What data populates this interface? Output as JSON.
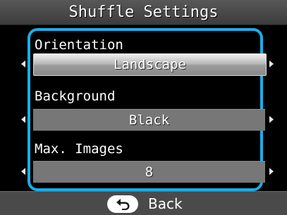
{
  "header": {
    "title": "Shuffle Settings"
  },
  "settings": [
    {
      "label": "Orientation",
      "value": "Landscape"
    },
    {
      "label": "Background",
      "value": "Black"
    },
    {
      "label": "Max. Images",
      "value": "8"
    }
  ],
  "footer": {
    "back_label": "Back",
    "back_icon": "return-arrow-icon"
  },
  "colors": {
    "panel_border": "#1aaee6",
    "selected_fill": "#bdbdbd",
    "unselected_fill": "#777777",
    "background": "#000000"
  }
}
